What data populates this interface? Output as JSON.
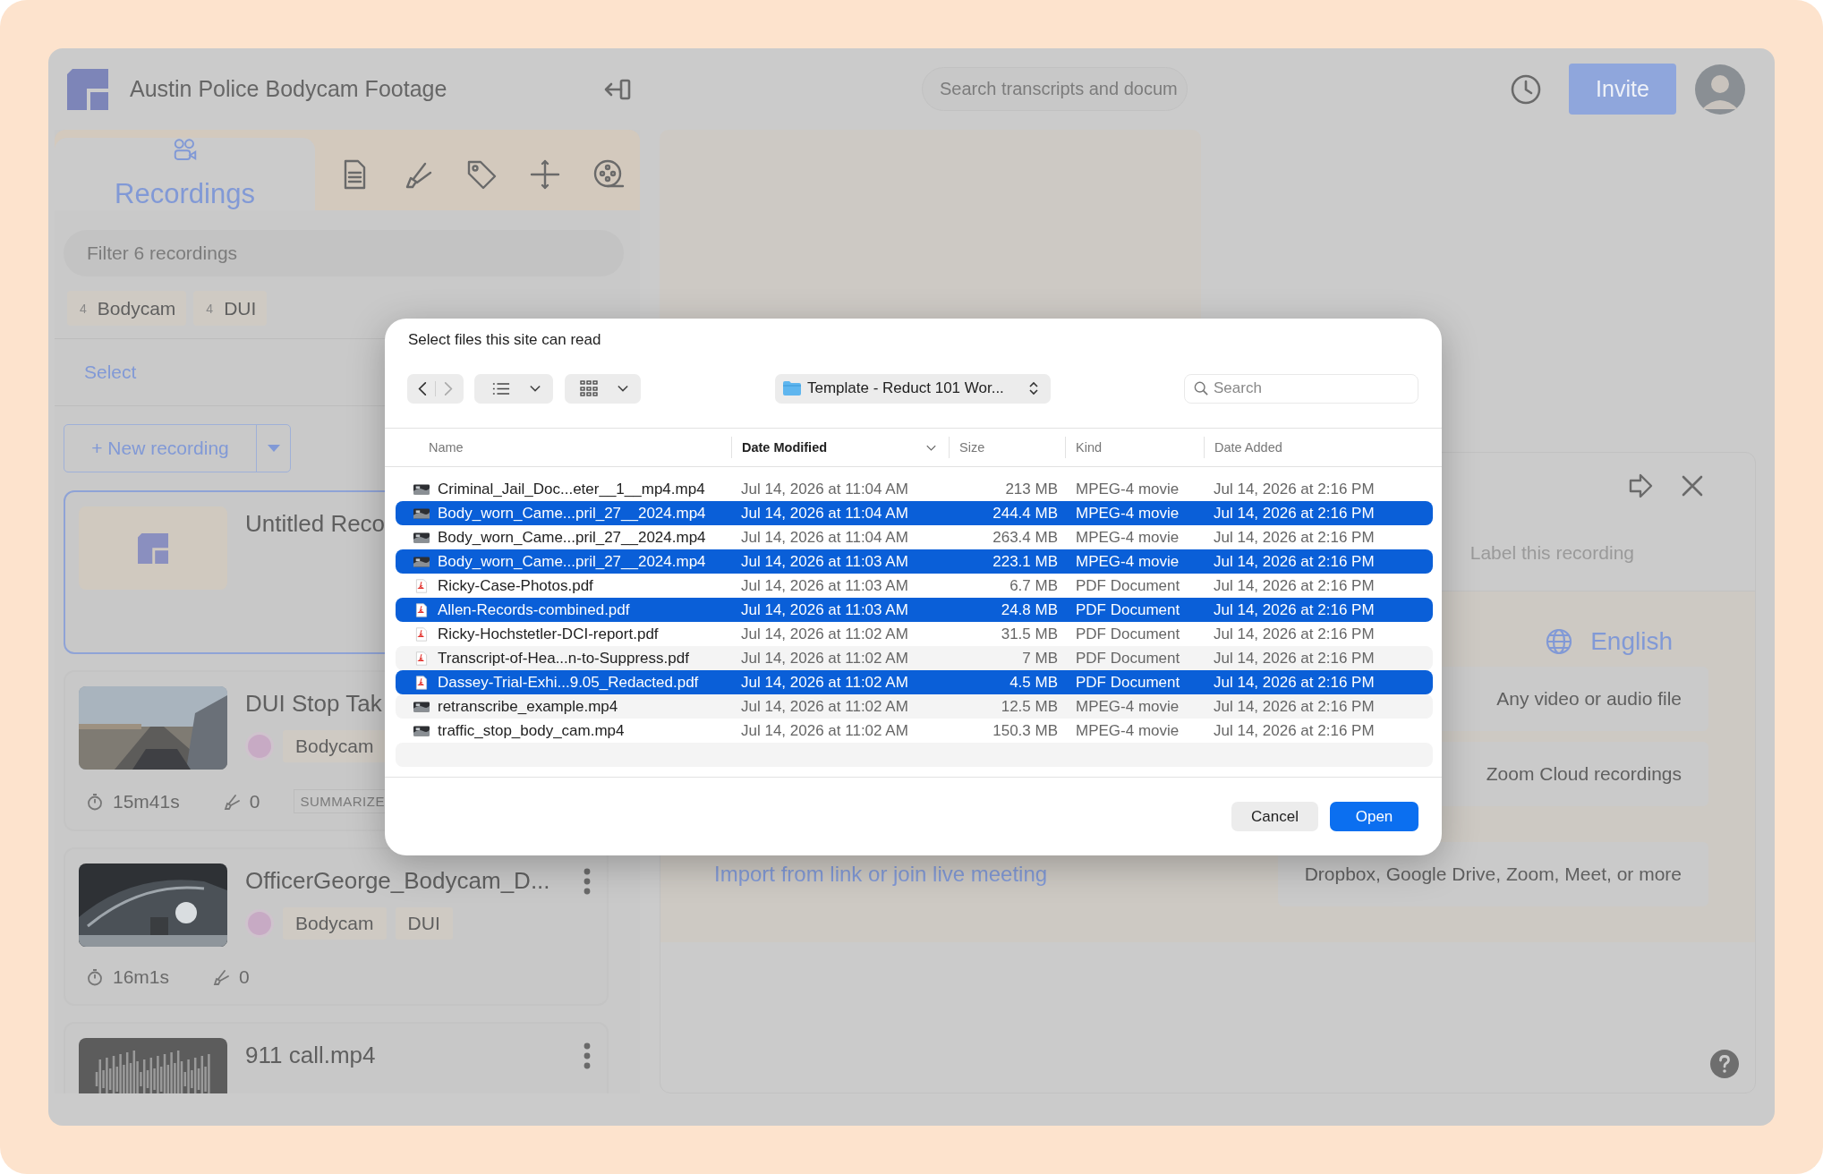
{
  "app": {
    "title": "Austin Police Bodycam Footage",
    "search": {
      "placeholder": "Search transcripts and docum"
    },
    "invite": "Invite"
  },
  "sidebar": {
    "tabs": [
      {
        "kind": "recordings",
        "label": "Recordings",
        "selected": true
      },
      {
        "kind": "document",
        "selected": false
      },
      {
        "kind": "highlighter",
        "selected": false
      },
      {
        "kind": "tag",
        "selected": false
      },
      {
        "kind": "plus",
        "selected": false
      },
      {
        "kind": "reel",
        "selected": false
      }
    ],
    "filter": {
      "placeholder": "Filter 6 recordings"
    },
    "tags": [
      {
        "count": "4",
        "label": "Bodycam"
      },
      {
        "count": "4",
        "label": "DUI"
      }
    ],
    "select": "Select",
    "new_recording": "+ New recording",
    "recordings": [
      {
        "title": "Untitled Reco",
        "kind": "logo",
        "selected": true,
        "menu": false
      },
      {
        "title": "DUI Stop Tak",
        "kind": "picture",
        "selected": false,
        "menu": false,
        "tags": [
          "Bodycam"
        ],
        "duration": "15m41s",
        "highlights": "0",
        "status": "SUMMARIZE"
      },
      {
        "title": "OfficerGeorge_Bodycam_D...",
        "kind": "picture",
        "selected": false,
        "menu": true,
        "tags": [
          "Bodycam",
          "DUI"
        ],
        "duration": "16m1s",
        "highlights": "0"
      },
      {
        "title": "911 call.mp4",
        "kind": "waveform",
        "selected": false,
        "menu": true
      }
    ]
  },
  "panel": {
    "label_placeholder": "Label this recording",
    "language": "English",
    "sources": [
      {
        "label": "Any video or audio file"
      },
      {
        "label": "Zoom Cloud recordings"
      },
      {
        "action": "Import from link or join live meeting",
        "label": "Dropbox, Google Drive, Zoom, Meet, or more"
      }
    ]
  },
  "dialog": {
    "title": "Select files this site can read",
    "location": "Template - Reduct 101 Wor...",
    "search": {
      "placeholder": "Search"
    },
    "columns": [
      {
        "label": "Name",
        "sorted": false
      },
      {
        "label": "Date Modified",
        "sorted": true
      },
      {
        "label": "Size",
        "sorted": false
      },
      {
        "label": "Kind",
        "sorted": false
      },
      {
        "label": "Date Added",
        "sorted": false
      }
    ],
    "files": [
      {
        "kind": "video",
        "name": "Criminal_Jail_Doc...eter__1__mp4.mp4",
        "modified": "Jul 14, 2026 at 11:04 AM",
        "size": "213 MB",
        "type": "MPEG-4 movie",
        "added": "Jul 14, 2026 at 2:16 PM",
        "selected": false
      },
      {
        "kind": "video",
        "name": "Body_worn_Came...pril_27__2024.mp4",
        "modified": "Jul 14, 2026 at 11:04 AM",
        "size": "244.4 MB",
        "type": "MPEG-4 movie",
        "added": "Jul 14, 2026 at 2:16 PM",
        "selected": true
      },
      {
        "kind": "video",
        "name": "Body_worn_Came...pril_27__2024.mp4",
        "modified": "Jul 14, 2026 at 11:04 AM",
        "size": "263.4 MB",
        "type": "MPEG-4 movie",
        "added": "Jul 14, 2026 at 2:16 PM",
        "selected": false
      },
      {
        "kind": "video",
        "name": "Body_worn_Came...pril_27__2024.mp4",
        "modified": "Jul 14, 2026 at 11:03 AM",
        "size": "223.1 MB",
        "type": "MPEG-4 movie",
        "added": "Jul 14, 2026 at 2:16 PM",
        "selected": true
      },
      {
        "kind": "pdf",
        "name": "Ricky-Case-Photos.pdf",
        "modified": "Jul 14, 2026 at 11:03 AM",
        "size": "6.7 MB",
        "type": "PDF Document",
        "added": "Jul 14, 2026 at 2:16 PM",
        "selected": false
      },
      {
        "kind": "pdf",
        "name": "Allen-Records-combined.pdf",
        "modified": "Jul 14, 2026 at 11:03 AM",
        "size": "24.8 MB",
        "type": "PDF Document",
        "added": "Jul 14, 2026 at 2:16 PM",
        "selected": true
      },
      {
        "kind": "pdf",
        "name": "Ricky-Hochstetler-DCI-report.pdf",
        "modified": "Jul 14, 2026 at 11:02 AM",
        "size": "31.5 MB",
        "type": "PDF Document",
        "added": "Jul 14, 2026 at 2:16 PM",
        "selected": false
      },
      {
        "kind": "pdf",
        "name": "Transcript-of-Hea...n-to-Suppress.pdf",
        "modified": "Jul 14, 2026 at 11:02 AM",
        "size": "7 MB",
        "type": "PDF Document",
        "added": "Jul 14, 2026 at 2:16 PM",
        "selected": false
      },
      {
        "kind": "pdf",
        "name": "Dassey-Trial-Exhi...9.05_Redacted.pdf",
        "modified": "Jul 14, 2026 at 11:02 AM",
        "size": "4.5 MB",
        "type": "PDF Document",
        "added": "Jul 14, 2026 at 2:16 PM",
        "selected": true
      },
      {
        "kind": "video",
        "name": "retranscribe_example.mp4",
        "modified": "Jul 14, 2026 at 11:02 AM",
        "size": "12.5 MB",
        "type": "MPEG-4 movie",
        "added": "Jul 14, 2026 at 2:16 PM",
        "selected": false
      },
      {
        "kind": "video",
        "name": "traffic_stop_body_cam.mp4",
        "modified": "Jul 14, 2026 at 11:02 AM",
        "size": "150.3 MB",
        "type": "MPEG-4 movie",
        "added": "Jul 14, 2026 at 2:16 PM",
        "selected": false
      }
    ],
    "buttons": [
      {
        "kind": "cancel",
        "label": "Cancel"
      },
      {
        "kind": "default",
        "label": "Open"
      }
    ]
  }
}
